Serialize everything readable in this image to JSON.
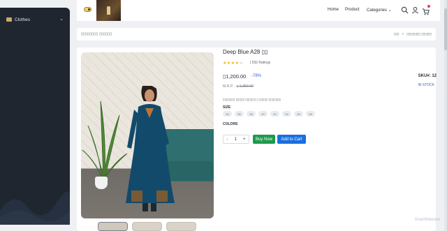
{
  "sidebar": {
    "items": [
      {
        "label": "Clothes",
        "icon": "clothes-icon"
      }
    ]
  },
  "header": {
    "nav": {
      "home": "Home",
      "product": "Product",
      "categories": "Categories"
    },
    "icons": [
      "search-icon",
      "user-icon",
      "cart-icon"
    ],
    "cart_badge_color": "#e53950"
  },
  "breadcrumb": {
    "title": "▯▯▯▯▯▯▯▯ ▯▯▯▯▯▯",
    "home": "▯▯▯",
    "separator": ">",
    "current": "▯▯▯▯▯▯▯▯ ▯▯▯▯▯▯"
  },
  "product": {
    "title": "Deep Blue A28 ▯▯",
    "stars": "★★★★",
    "stars_dim": "★",
    "rating_value": 4,
    "rating_count": "| 592 Ratings",
    "price": "▯1,200.00",
    "discount": "-78%",
    "mrp_label": "M.R.P. : ",
    "mrp_value": "▯ 1,350.00",
    "sku": "SKU#: 12",
    "stock": "IN STOCK",
    "description": "▯▯▯▯▯▯▯ ▯▯▯▯▯ ▯▯▯▯▯▯ ▯ ▯▯▯▯▯ ▯▯▯▯▯▯▯",
    "size_label": "SIZE",
    "sizes": [
      "34",
      "36",
      "38",
      "40",
      "42",
      "44",
      "46",
      "48"
    ],
    "colors_label": "COLORS",
    "quantity": "1",
    "minus": "-",
    "plus": "+",
    "buy_now": "Buy Now",
    "add_to_cart": "Add to Cart"
  },
  "watermark": "ScanMalware",
  "colors": {
    "sidebar_bg": "#1f2630",
    "accent_blue": "#1a6fe0",
    "accent_green": "#1e9a4b",
    "star": "#f1b41c"
  }
}
